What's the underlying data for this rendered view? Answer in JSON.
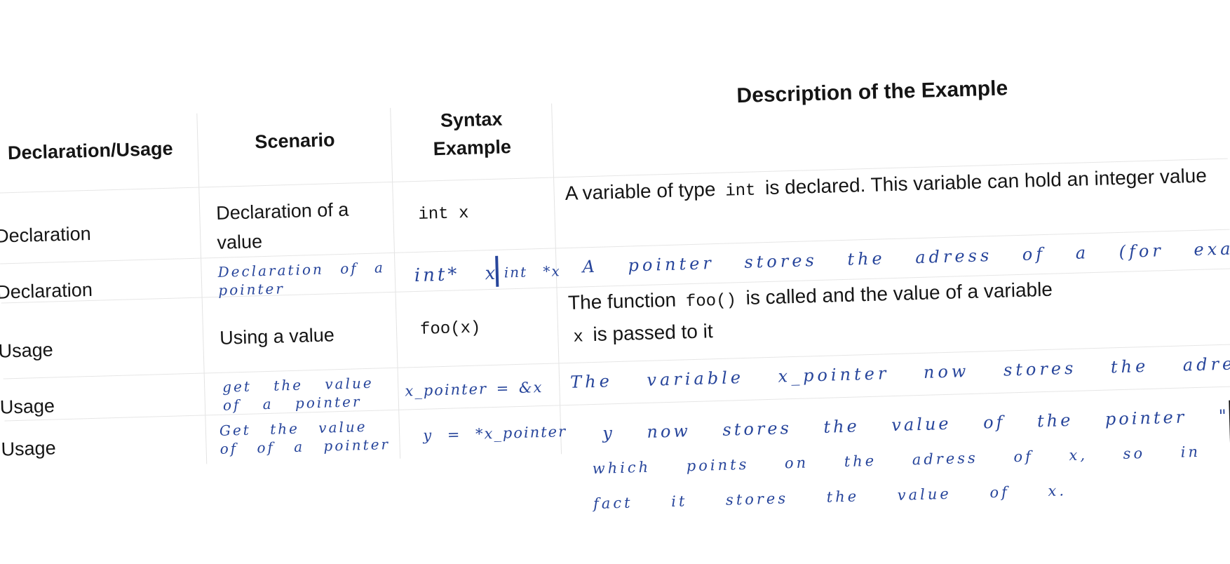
{
  "headers": [
    "Declaration/Usage",
    "Scenario",
    "Syntax Example",
    "Description of the Example"
  ],
  "rows": [
    {
      "kind": "Declaration",
      "scenario": "Declaration of a value",
      "syntax": "int x",
      "description_before": "A variable of type",
      "description_code": "int",
      "description_after": "is declared. This variable can hold an integer value"
    },
    {
      "kind": "Declaration",
      "scenario": "Declaration of a pointer",
      "syntax_left": "int* x",
      "syntax_right": "int *x",
      "description": "A pointer stores the adress of a (for example) int"
    },
    {
      "kind": "Usage",
      "scenario": "Using a value",
      "syntax": "foo(x)",
      "description_before": "The function",
      "description_code": "foo()",
      "description_middle": "is called and the value of a variable",
      "description_code2": "x",
      "description_after": "is passed to it"
    },
    {
      "kind": "Usage",
      "scenario": "get the value of a pointer",
      "syntax": "x_pointer = &x",
      "description": "The variable x_pointer now stores the adress of x"
    },
    {
      "kind": "Usage",
      "scenario": "Get the value of of a pointer",
      "syntax": "y = *x_pointer",
      "description_line1": "y now stores the value of the pointer \"x_pointer\"",
      "description_line2": "which points on the adress of x, so in",
      "description_line3": "fact it stores the value of x."
    }
  ]
}
